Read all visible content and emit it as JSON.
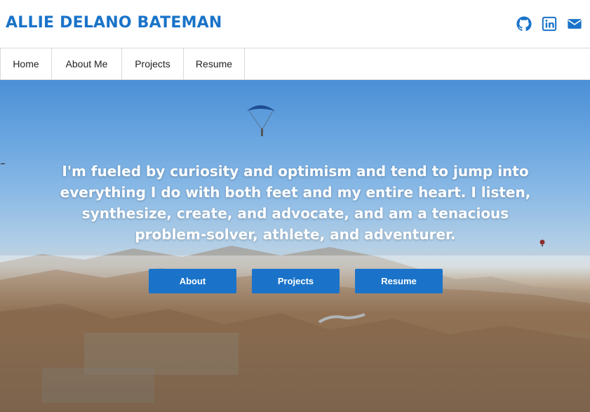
{
  "header": {
    "title": "ALLIE DELANO BATEMAN",
    "social_icons": [
      "github-icon",
      "linkedin-icon",
      "mail-icon"
    ],
    "accent_color": "#1a73c9"
  },
  "nav": {
    "items": [
      "Home",
      "About Me",
      "Projects",
      "Resume"
    ]
  },
  "hero": {
    "tagline": "I'm fueled by curiosity and optimism and tend to jump into everything I do with both feet and my entire heart. I listen, synthesize, create, and advocate, and am a tenacious problem-solver, athlete, and adventurer.",
    "buttons": [
      "About",
      "Projects",
      "Resume"
    ]
  }
}
